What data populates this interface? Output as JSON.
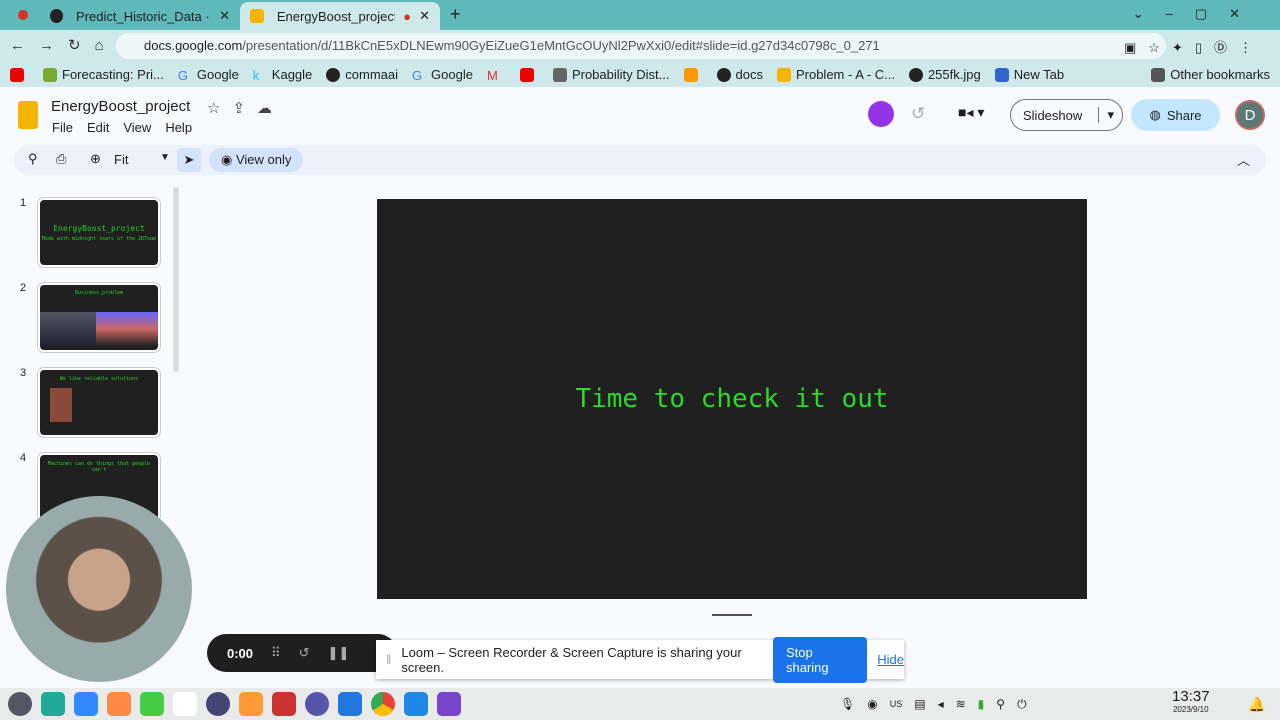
{
  "browser": {
    "tabs": [
      {
        "label": "Predict_Historic_Data · Str"
      },
      {
        "label": "EnergyBoost_project - "
      }
    ],
    "url_host": "docs.google.com",
    "url_path": "/presentation/d/11BkCnE5xDLNEwm90GyEiZueG1eMntGcOUyNl2PwXxi0/edit#slide=id.g27d34c0798c_0_271",
    "bookmarks": [
      "Forecasting: Pri...",
      "Google",
      "Kaggle",
      "commaai",
      "Google",
      "Probability Dist...",
      "docs",
      "Problem - A - C...",
      "255fk.jpg",
      "New Tab"
    ],
    "other_bookmarks": "Other bookmarks"
  },
  "doc": {
    "title": "EnergyBoost_project",
    "menu": [
      "File",
      "Edit",
      "View",
      "Help"
    ],
    "slideshow": "Slideshow",
    "share": "Share",
    "avatar": "D",
    "zoom": "Fit",
    "view_only": "View only"
  },
  "slides": [
    {
      "num": "1",
      "title": "EnergyBoost_project",
      "subtitle": "Made with midnight tears of the 2DTeam"
    },
    {
      "num": "2",
      "title": "Business problem"
    },
    {
      "num": "3",
      "title": "We like reliable solutions"
    },
    {
      "num": "4",
      "title": "Machines can do things that people can't"
    }
  ],
  "current_slide": {
    "text": "Time to check it out"
  },
  "loom": {
    "timer": "0:00",
    "message": "Loom – Screen Recorder & Screen Capture is sharing your screen.",
    "stop": "Stop sharing",
    "hide": "Hide"
  },
  "taskbar": {
    "lang": "US",
    "time": "13:37",
    "date": "2023/9/10"
  },
  "colors": {
    "tabbar": "#5fb8b9",
    "slide_bg": "#202020",
    "slide_text": "#2bd82b",
    "accent": "#1a73e8"
  }
}
